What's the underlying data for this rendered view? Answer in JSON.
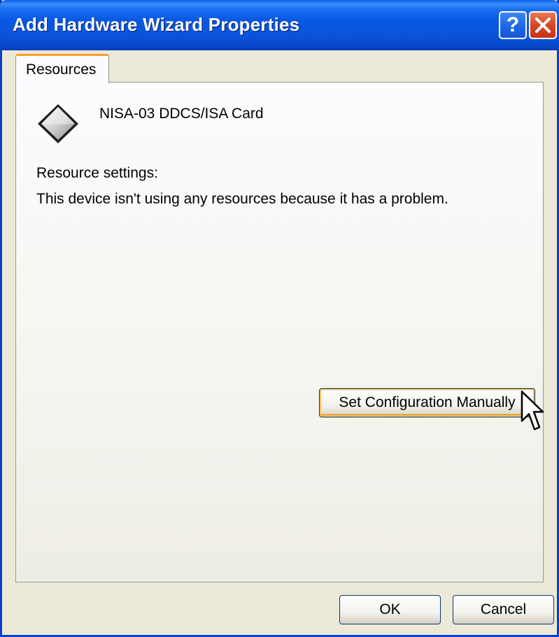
{
  "window": {
    "title": "Add Hardware Wizard Properties",
    "help_label": "?",
    "titlebar_color": "#0A54DB",
    "close_color": "#D84722"
  },
  "tabs": [
    {
      "label": "Resources",
      "active": true
    }
  ],
  "device": {
    "icon": "isa-card-diamond-icon",
    "name": "NISA-03 DDCS/ISA Card"
  },
  "resources": {
    "settings_label": "Resource settings:",
    "status_text": "This device isn't using any resources because it has a problem."
  },
  "buttons": {
    "set_config": "Set Configuration Manually",
    "ok": "OK",
    "cancel": "Cancel"
  },
  "cursor": {
    "icon": "arrow-cursor-icon"
  }
}
